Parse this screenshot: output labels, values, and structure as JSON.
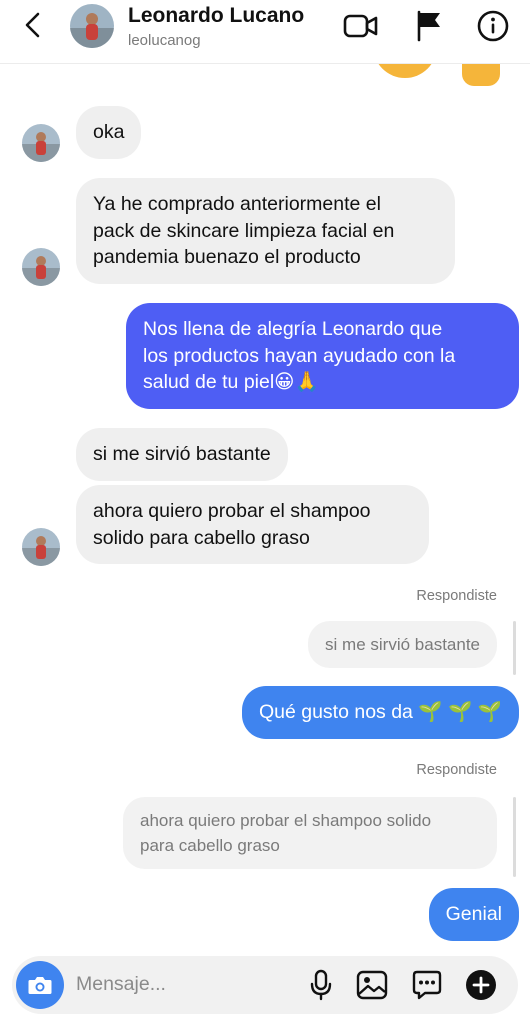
{
  "header": {
    "name": "Leonardo Lucano",
    "username": "leolucanog",
    "icons": [
      "back-chevron-icon",
      "video-call-icon",
      "flag-icon",
      "info-icon"
    ]
  },
  "messages": [
    {
      "from": "contact",
      "text": "oka"
    },
    {
      "from": "contact",
      "lines": [
        "Ya he comprado anteriormente el",
        "pack de skincare limpieza facial en",
        "pandemia buenazo el producto"
      ]
    },
    {
      "from": "me",
      "lines": [
        "Nos llena de alegría Leonardo que",
        "los productos hayan ayudado con la",
        "salud de tu piel😀🙏"
      ]
    },
    {
      "from": "contact",
      "text": "si me sirvió bastante"
    },
    {
      "from": "contact",
      "lines": [
        "ahora quiero probar el shampoo",
        "solido para cabello graso"
      ]
    }
  ],
  "replies": [
    {
      "label": "Respondiste",
      "quoted": "si me sirvió bastante",
      "text": "Qué gusto nos da 🌱 🌱 🌱"
    },
    {
      "label": "Respondiste",
      "quoted_lines": [
        "ahora quiero probar el shampoo solido",
        "para cabello graso"
      ],
      "text": "Genial"
    }
  ],
  "composer": {
    "placeholder": "Mensaje...",
    "icons": [
      "camera-icon",
      "microphone-icon",
      "gallery-icon",
      "sticker-icon",
      "plus-icon"
    ]
  },
  "colors": {
    "outgoing": "#4e5ef4",
    "outgoing_latest": "#3f84ef",
    "incoming": "#efefef",
    "muted_text": "#7a7a7a"
  }
}
